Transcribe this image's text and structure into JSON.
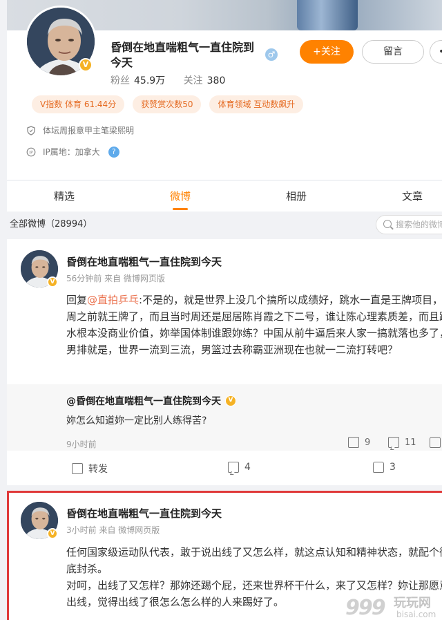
{
  "profile": {
    "name": "昏倒在地直喘粗气一直住院到今天",
    "gender_symbol": "♂",
    "followers_label": "粉丝",
    "followers_value": "45.9万",
    "following_label": "关注",
    "following_value": "380",
    "follow_button": "+关注",
    "message_button": "留言",
    "more_button": "•",
    "tags": [
      "V指数 体育 61.44分",
      "获赞赏次数50",
      "体育领域 互动数飙升"
    ],
    "verify_text": "体坛周报意甲主笔梁熙明",
    "ip_text": "IP属地：加拿大",
    "help_icon_text": "?",
    "vbadge_text": "V"
  },
  "tabs": [
    "精选",
    "微博",
    "相册",
    "文章"
  ],
  "active_tab": 1,
  "all_weibo": "全部微博（28994）",
  "search_placeholder": "搜索他的微博",
  "post1": {
    "author": "昏倒在地直喘粗气一直住院到今天",
    "time": "56分钟前  来自 微博网页版",
    "reply_prefix": "回复",
    "mention": "@直拍乒乓",
    "text": ":不是的，就是世界上没几个搞所以成绩好，跳水一直是王牌项目，周之前就王牌了，而且当时周还是屈居陈肖霞之下二号，谁让陈心理素质差，而且跳水根本没商业价值，妳举国体制谁跟妳练？中国从前牛逼后来人家一搞就落也多了，男排就是，世界一流到三流，男篮过去称霸亚洲现在也就一二流打转吧？",
    "quote_author": "@昏倒在地直喘粗气一直住院到今天",
    "quote_text": "妳怎么知道妳一定比别人练得苦?",
    "quote_time": "9小时前",
    "quote_reposts": "9",
    "quote_comments": "11",
    "repost_label": "转发",
    "comments": "4",
    "likes": "3"
  },
  "post2": {
    "author": "昏倒在地直喘粗气一直住院到今天",
    "time": "3小时前  来自 微博网页版",
    "text": "任何国家级运动队代表，敢于说出线了又怎么样，就这点认知和精神状态，就配个彻底封杀。\n对呵，出线了又怎样？那妳还踢个屁，还来世界杯干什么，来了又怎样？妳让那愿意出线，觉得出线了很怎么怎么样的人来踢好了。"
  },
  "watermark": {
    "number": "999",
    "text": "玩玩网",
    "url": "bisai.com"
  }
}
